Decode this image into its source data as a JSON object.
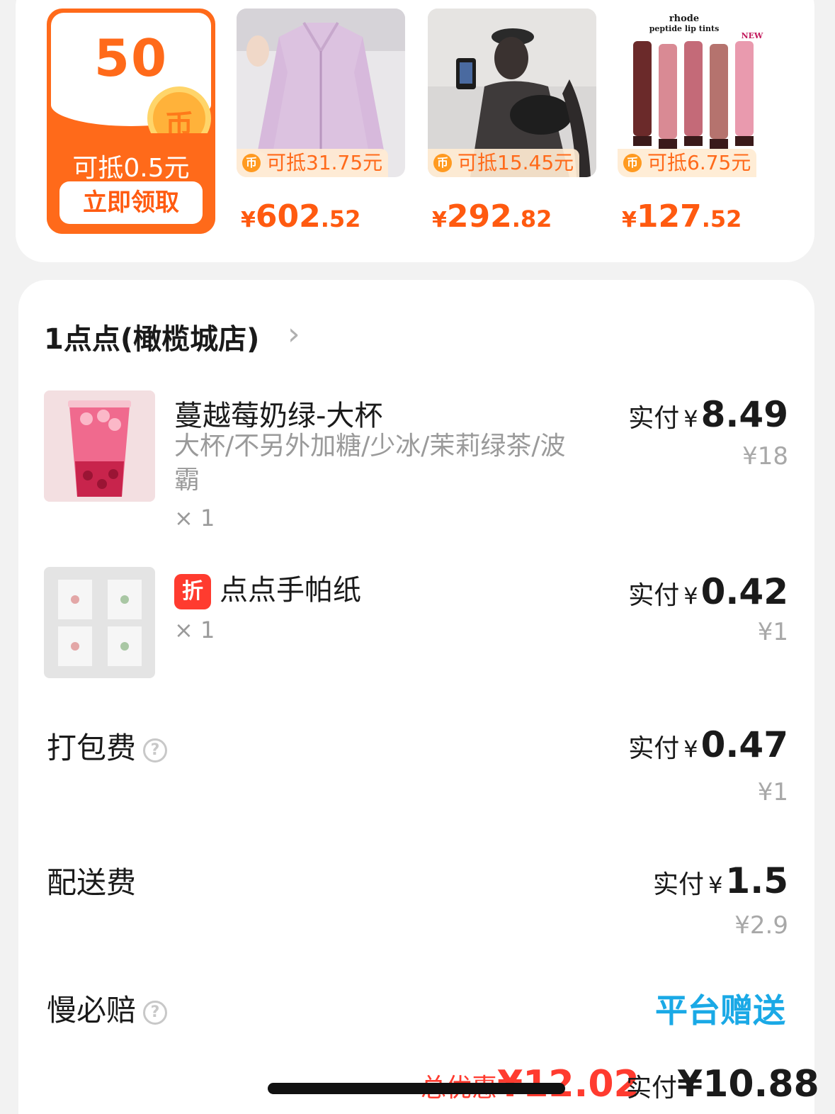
{
  "promo": {
    "coin_card": {
      "amount": "50",
      "coin_glyph": "币",
      "label": "可抵0.5元",
      "button": "立即领取"
    },
    "products": [
      {
        "badge": "可抵31.75元",
        "yen": "¥",
        "price_int": "602",
        "price_dec": ".52",
        "image": "lavender-zip-jacket"
      },
      {
        "badge": "可抵15.45元",
        "yen": "¥",
        "price_int": "292",
        "price_dec": ".82",
        "image": "woman-with-black-crossbody-bag"
      },
      {
        "badge": "可抵6.75元",
        "yen": "¥",
        "price_int": "127",
        "price_dec": ".52",
        "image": "rhode-peptide-lip-tints",
        "image_text": {
          "brand": "rhode",
          "subtitle": "peptide lip tints",
          "tag": "NEW"
        }
      }
    ],
    "coin_glyph_small": "币"
  },
  "order": {
    "shop_name": "1点点(橄榄城店)",
    "chevron": "›",
    "items": [
      {
        "title": "蔓越莓奶绿-大杯",
        "spec": "大杯/不另外加糖/少冰/茉莉绿茶/波霸",
        "qty": "× 1",
        "pay_label": "实付",
        "yen": "¥",
        "pay_amount": "8.49",
        "original": "¥18"
      },
      {
        "tag": "折",
        "title": "点点手帕纸",
        "qty": "× 1",
        "pay_label": "实付",
        "yen": "¥",
        "pay_amount": "0.42",
        "original": "¥1"
      }
    ],
    "fees": [
      {
        "label": "打包费",
        "help": "?",
        "pay_label": "实付",
        "yen": "¥",
        "pay_amount": "0.47",
        "original": "¥1"
      },
      {
        "label": "配送费",
        "pay_label": "实付",
        "yen": "¥",
        "pay_amount": "1.5",
        "original": "¥2.9"
      },
      {
        "label": "慢必赔",
        "help": "?",
        "value": "平台赠送"
      }
    ],
    "summary": {
      "discount_label": "总优惠",
      "discount_amount": "¥12.02",
      "pay_label": "实付",
      "pay_amount": "¥10.88"
    }
  },
  "colors": {
    "accent_orange": "#ff6a1a",
    "price_orange": "#ff5a10",
    "discount_red": "#ff3b2f",
    "gift_blue": "#1aa9e6"
  }
}
